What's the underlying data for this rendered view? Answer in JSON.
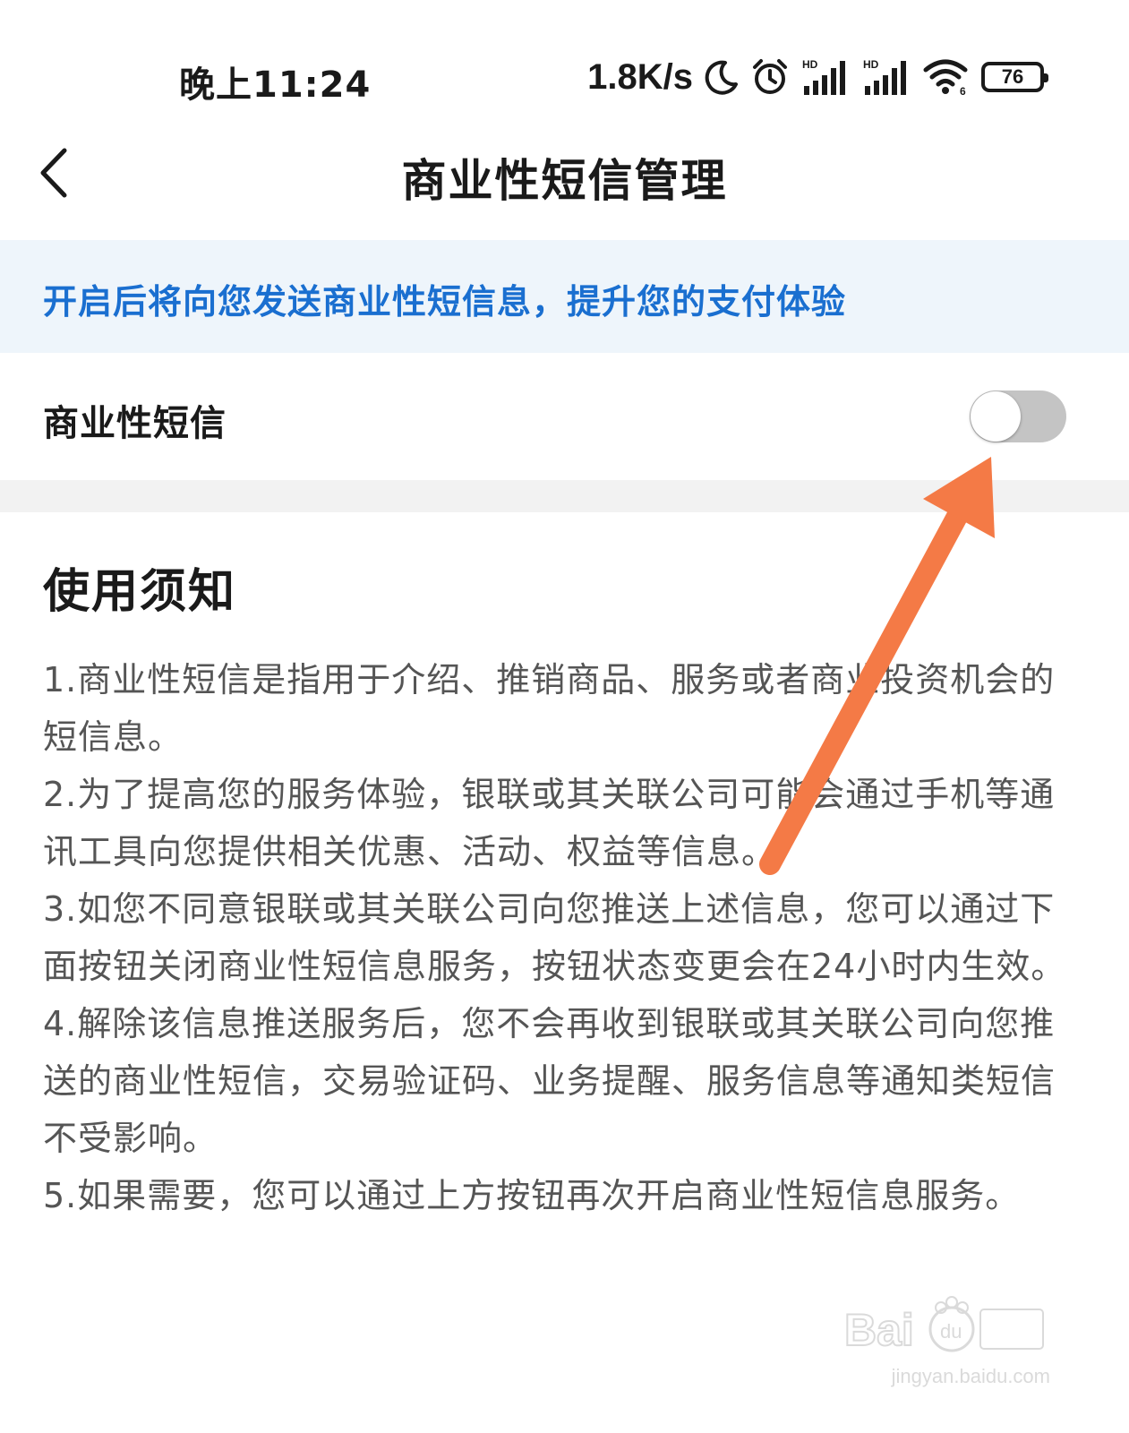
{
  "status_bar": {
    "time": "晚上11:24",
    "net_speed": "1.8K/s",
    "battery_level": "76",
    "icons": [
      "moon-icon",
      "alarm-icon",
      "signal-hd-icon",
      "signal-hd-icon",
      "wifi-icon",
      "battery-icon"
    ]
  },
  "header": {
    "title": "商业性短信管理",
    "back_icon": "chevron-left-icon"
  },
  "banner": {
    "text": "开启后将向您发送商业性短信息，提升您的支付体验",
    "color": "#1a6fd0"
  },
  "setting": {
    "label": "商业性短信",
    "enabled": false
  },
  "notice": {
    "title": "使用须知",
    "items": [
      "1.商业性短信是指用于介绍、推销商品、服务或者商业投资机会的短信息。",
      "2.为了提高您的服务体验，银联或其关联公司可能会通过手机等通讯工具向您提供相关优惠、活动、权益等信息。",
      "3.如您不同意银联或其关联公司向您推送上述信息，您可以通过下面按钮关闭商业性短信息服务，按钮状态变更会在24小时内生效。",
      "4.解除该信息推送服务后，您不会再收到银联或其关联公司向您推送的商业性短信，交易验证码、业务提醒、服务信息等通知类短信不受影响。",
      "5.如果需要，您可以通过上方按钮再次开启商业性短信息服务。"
    ]
  },
  "annotation": {
    "arrow_color": "#f47a46"
  },
  "watermark": {
    "domain": "jingyan.baidu.com"
  }
}
